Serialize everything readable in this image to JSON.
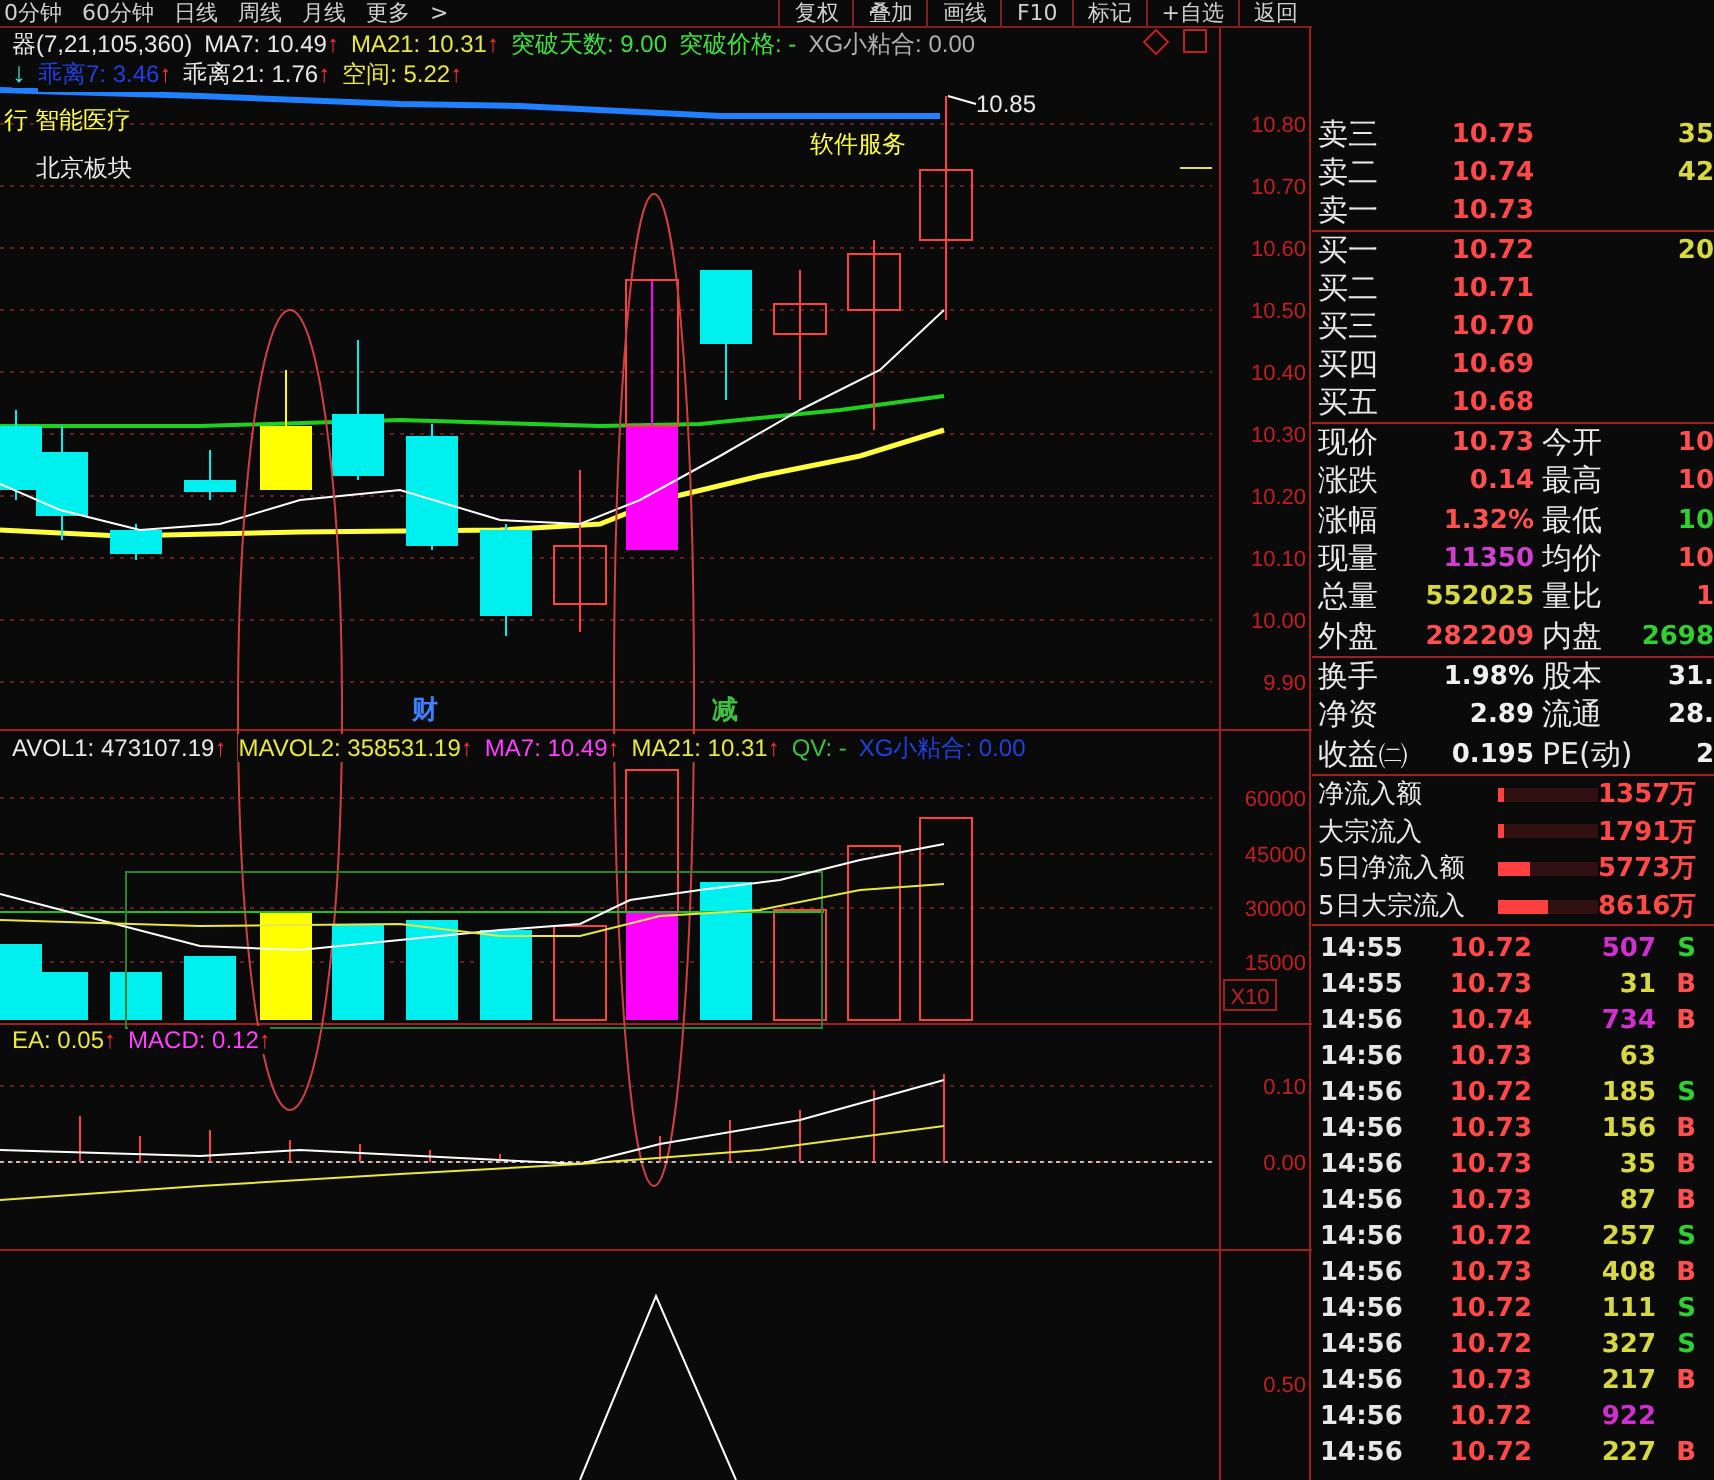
{
  "toolbar": {
    "periods": [
      "0分钟",
      "60分钟",
      "日线",
      "周线",
      "月线",
      "更多",
      ">"
    ],
    "buttons": [
      "复权",
      "叠加",
      "画线",
      "F10",
      "标记",
      "+自选",
      "返回"
    ]
  },
  "main_chart": {
    "indicators": [
      {
        "text": "器(7,21,105,360)",
        "color": "#e8e8e8"
      },
      {
        "text": "MA7: 10.49",
        "arrow": "↑",
        "color": "#e8e8e8"
      },
      {
        "text": "MA21: 10.31",
        "arrow": "↑",
        "color": "#e8e840"
      },
      {
        "text": "突破天数: 9.00",
        "color": "#40e040"
      },
      {
        "text": "突破价格: -",
        "color": "#40e040"
      },
      {
        "text": "XG小粘合: 0.00",
        "color": "#b0b0b0"
      }
    ],
    "indicators_2": [
      {
        "text": "↓",
        "color": "#40e0e0"
      },
      {
        "text": "乖离7: 3.46",
        "arrow": "↑",
        "color": "#2040e0"
      },
      {
        "text": "乖离21: 1.76",
        "arrow": "↑",
        "color": "#e8e8e8"
      },
      {
        "text": "空间: 5.22",
        "arrow": "↑",
        "color": "#e8e840"
      }
    ],
    "labels": [
      {
        "text": "行 智能医疗",
        "kind": "sector"
      },
      {
        "text": "北京板块",
        "kind": "sector"
      },
      {
        "text": "软件服务",
        "kind": "sector"
      },
      {
        "text": "10.85",
        "kind": "peak"
      },
      {
        "text": "财",
        "kind": "event",
        "color": "#4080ff"
      },
      {
        "text": "减",
        "kind": "event",
        "color": "#40c040"
      }
    ],
    "axis": [
      "10.80",
      "10.70",
      "10.60",
      "10.50",
      "10.40",
      "10.30",
      "10.20",
      "10.10",
      "10.00",
      "9.90"
    ]
  },
  "volume_chart": {
    "indicators": [
      {
        "text": "AVOL1: 473107.19",
        "arrow": "↑",
        "color": "#e8e8e8"
      },
      {
        "text": "MAVOL2: 358531.19",
        "arrow": "↑",
        "color": "#e8e840"
      },
      {
        "text": "MA7: 10.49",
        "arrow": "↑",
        "color": "#ff40ff"
      },
      {
        "text": "MA21: 10.31",
        "arrow": "↑",
        "color": "#e8e840"
      },
      {
        "text": "QV: -",
        "color": "#40c040"
      },
      {
        "text": "XG小粘合: 0.00",
        "color": "#2040e0"
      }
    ],
    "axis": [
      "60000",
      "45000",
      "30000",
      "15000"
    ],
    "scale": "X10"
  },
  "macd_chart": {
    "indicators": [
      {
        "text": "EA: 0.05",
        "arrow": "↑",
        "color": "#e8e840"
      },
      {
        "text": "MACD: 0.12",
        "arrow": "↑",
        "color": "#ff40ff"
      }
    ],
    "axis": [
      "0.10",
      "0.00"
    ]
  },
  "bottom_chart": {
    "axis": [
      "0.50"
    ]
  },
  "order_book": [
    {
      "label": "卖三",
      "price": "10.75",
      "volume": "35"
    },
    {
      "label": "卖二",
      "price": "10.74",
      "volume": "42"
    },
    {
      "label": "卖一",
      "price": "10.73"
    },
    {
      "label": "买一",
      "price": "10.72",
      "volume": "20"
    },
    {
      "label": "买二",
      "price": "10.71"
    },
    {
      "label": "买三",
      "price": "10.70"
    },
    {
      "label": "买四",
      "price": "10.69"
    },
    {
      "label": "买五",
      "price": "10.68"
    }
  ],
  "quote_stats": [
    {
      "left": {
        "label": "现价",
        "value": "10.73",
        "color": "#ff5050"
      },
      "right": {
        "label": "今开",
        "value": "10",
        "color": "#ff5050"
      }
    },
    {
      "left": {
        "label": "涨跌",
        "value": "0.14",
        "color": "#ff5050"
      },
      "right": {
        "label": "最高",
        "value": "10",
        "color": "#ff5050"
      }
    },
    {
      "left": {
        "label": "涨幅",
        "value": "1.32%",
        "color": "#ff5050"
      },
      "right": {
        "label": "最低",
        "value": "10",
        "color": "#30d030"
      }
    },
    {
      "left": {
        "label": "现量",
        "value": "11350",
        "color": "#d040d0"
      },
      "right": {
        "label": "均价",
        "value": "10",
        "color": "#ff5050"
      }
    },
    {
      "left": {
        "label": "总量",
        "value": "552025",
        "color": "#d8d840"
      },
      "right": {
        "label": "量比",
        "value": "1",
        "color": "#ff5050"
      }
    },
    {
      "left": {
        "label": "外盘",
        "value": "282209",
        "color": "#ff5050"
      },
      "right": {
        "label": "内盘",
        "value": "2698",
        "color": "#30d030"
      }
    }
  ],
  "finance_stats": [
    {
      "label": "换手",
      "value": "1.98%",
      "label_2": "股本",
      "value_2": "31."
    },
    {
      "label": "净资",
      "value": "2.89",
      "label_2": "流通",
      "value_2": "28."
    },
    {
      "label": "收益㈡",
      "value": "0.195",
      "label_2": "PE(动)",
      "value_2": "2"
    }
  ],
  "fund_flow": [
    {
      "label": "净流入额",
      "level": 0.06,
      "value": "1357万"
    },
    {
      "label": "大宗流入",
      "level": 0.06,
      "value": "1791万"
    },
    {
      "label": "5日净流入额",
      "level": 0.32,
      "value": "5773万"
    },
    {
      "label": "5日大宗流入",
      "level": 0.5,
      "value": "8616万"
    }
  ],
  "trades": [
    {
      "time": "14:55",
      "price": "10.72",
      "volume": "507",
      "color": "#d030d0",
      "side": "S",
      "kind": "sell"
    },
    {
      "time": "14:55",
      "price": "10.73",
      "volume": "31",
      "color": "#d8d840",
      "side": "B",
      "kind": "buy"
    },
    {
      "time": "14:56",
      "price": "10.74",
      "volume": "734",
      "color": "#d030d0",
      "side": "B",
      "kind": "buy"
    },
    {
      "time": "14:56",
      "price": "10.73",
      "volume": "63",
      "color": "#d8d840"
    },
    {
      "time": "14:56",
      "price": "10.72",
      "volume": "185",
      "color": "#d8d840",
      "side": "S",
      "kind": "sell"
    },
    {
      "time": "14:56",
      "price": "10.73",
      "volume": "156",
      "color": "#d8d840",
      "side": "B",
      "kind": "buy"
    },
    {
      "time": "14:56",
      "price": "10.73",
      "volume": "35",
      "color": "#d8d840",
      "side": "B",
      "kind": "buy"
    },
    {
      "time": "14:56",
      "price": "10.73",
      "volume": "87",
      "color": "#d8d840",
      "side": "B",
      "kind": "buy"
    },
    {
      "time": "14:56",
      "price": "10.72",
      "volume": "257",
      "color": "#d8d840",
      "side": "S",
      "kind": "sell"
    },
    {
      "time": "14:56",
      "price": "10.73",
      "volume": "408",
      "color": "#d8d840",
      "side": "B",
      "kind": "buy"
    },
    {
      "time": "14:56",
      "price": "10.72",
      "volume": "111",
      "color": "#d8d840",
      "side": "S",
      "kind": "sell"
    },
    {
      "time": "14:56",
      "price": "10.72",
      "volume": "327",
      "color": "#d8d840",
      "side": "S",
      "kind": "sell"
    },
    {
      "time": "14:56",
      "price": "10.73",
      "volume": "217",
      "color": "#d8d840",
      "side": "B",
      "kind": "buy"
    },
    {
      "time": "14:56",
      "price": "10.72",
      "volume": "922",
      "color": "#d030d0"
    },
    {
      "time": "14:56",
      "price": "10.72",
      "volume": "227",
      "color": "#d8d840",
      "side": "B",
      "kind": "buy"
    }
  ]
}
